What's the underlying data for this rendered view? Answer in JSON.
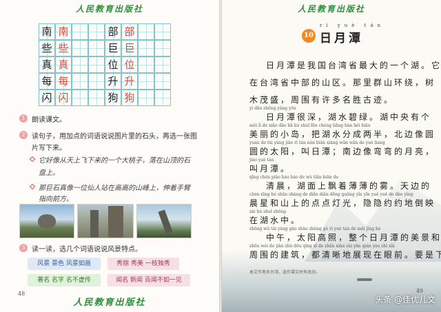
{
  "publisher": "人民教育出版社",
  "left": {
    "page_number": "48",
    "grid": [
      [
        {
          "c": "南",
          "t": "black"
        },
        {
          "c": "南",
          "t": "red"
        },
        {
          "c": "",
          "t": "black"
        },
        {
          "c": "",
          "t": "black"
        },
        {
          "c": "部",
          "t": "black"
        },
        {
          "c": "部",
          "t": "red"
        },
        {
          "c": "",
          "t": "black"
        },
        {
          "c": "",
          "t": "black"
        }
      ],
      [
        {
          "c": "些",
          "t": "black"
        },
        {
          "c": "些",
          "t": "red"
        },
        {
          "c": "",
          "t": "black"
        },
        {
          "c": "",
          "t": "black"
        },
        {
          "c": "巨",
          "t": "black"
        },
        {
          "c": "巨",
          "t": "red"
        },
        {
          "c": "",
          "t": "black"
        },
        {
          "c": "",
          "t": "black"
        }
      ],
      [
        {
          "c": "真",
          "t": "black"
        },
        {
          "c": "真",
          "t": "red"
        },
        {
          "c": "",
          "t": "black"
        },
        {
          "c": "",
          "t": "black"
        },
        {
          "c": "位",
          "t": "black"
        },
        {
          "c": "位",
          "t": "red"
        },
        {
          "c": "",
          "t": "black"
        },
        {
          "c": "",
          "t": "black"
        }
      ],
      [
        {
          "c": "每",
          "t": "black"
        },
        {
          "c": "每",
          "t": "red"
        },
        {
          "c": "",
          "t": "black"
        },
        {
          "c": "",
          "t": "black"
        },
        {
          "c": "升",
          "t": "black"
        },
        {
          "c": "升",
          "t": "red"
        },
        {
          "c": "",
          "t": "black"
        },
        {
          "c": "",
          "t": "black"
        }
      ],
      [
        {
          "c": "闪",
          "t": "black"
        },
        {
          "c": "闪",
          "t": "red"
        },
        {
          "c": "",
          "t": "black"
        },
        {
          "c": "",
          "t": "black"
        },
        {
          "c": "狗",
          "t": "black"
        },
        {
          "c": "狗",
          "t": "red"
        },
        {
          "c": "",
          "t": "black"
        },
        {
          "c": "",
          "t": "black"
        }
      ]
    ],
    "exercise1": "朗读课文。",
    "exercise2_line1": "读句子，用加点的词语说说图片里的石头，再选一张图",
    "exercise2_line2": "片写下来。",
    "example1_line1": "它好像从天上飞下来的一个大桃子，落在山顶的石",
    "example1_line2": "盘上。",
    "example2_line1": "那巨石真像一位仙人站在高高的山峰上，伸着手臂",
    "example2_line2": "指向前方。",
    "exercise3": "读一读，选几个词语说说风景特点。",
    "tags": [
      {
        "text": "风景  景色  风景如画",
        "color": "blue"
      },
      {
        "text": "秀丽  秀美  一枝独秀",
        "color": "pink"
      },
      {
        "text": "著名  名字  名不虚传",
        "color": "green"
      },
      {
        "text": "闻名  新闻  百闻不如一见",
        "color": "pink"
      }
    ]
  },
  "right": {
    "page_number": "49",
    "lesson_number": "10",
    "title_pinyin": "rì yuè tán",
    "title": "日月潭",
    "lines": [
      {
        "py": "",
        "hz": "日月潭是我国台湾省最大的一个湖。它"
      },
      {
        "py": "",
        "hz": "在台湾省中部的山区。那里群山环绕，树"
      },
      {
        "py": "",
        "hz": "木茂盛，周围有许多名胜古迹。"
      },
      {
        "py": "yì      dǎo                 zhōng yāng     yǒu",
        "hz": "日月潭很深，湖水碧绿。湖中央有个"
      },
      {
        "py": "měi   lì   de  xiǎo dǎo  bǎ  hú  shuǐ  fēn chéng liǎng bàn  běi  biān",
        "hz": "美丽的小岛，把湖水分成两半，北边像圆"
      },
      {
        "py": "yuán de  tài  yáng  jiào  rì  tán  nán  biān xiàng wān wān de  yuè  liang",
        "hz": "圆的太阳，叫日潭；南边像弯弯的月亮，"
      },
      {
        "py": "jiào yuè  tán",
        "hz": "叫月潭。"
      },
      {
        "py": "qīng  chén          piāo      báo  báo  de  wù   tiān biān de",
        "hz": "清晨，湖面上飘着薄薄的雾。天边的"
      },
      {
        "py": "chén xīng hé  shān shàng de  diǎn diǎn dēng guāng  yǐn  yǐn  yuē  yuē  de  dào  yìng",
        "hz": "晨星和山上的点点灯光，隐隐约约地倒映"
      },
      {
        "py": "zài  hú  shuǐ zhōng",
        "hz": "在湖水中。"
      },
      {
        "py": "zhōng wǔ   tài  yáng gāo  zhào  zhěng gè  rì  yuè  tán  de  měi  jǐng hé",
        "hz": "中午，太阳高照，整个日月潭的美景和"
      },
      {
        "py": "zhōu wéi  de  jiàn zhù   dōu qīng xī  de  zhǎn xiàn zài  yǎn  qián   yào  shì  xià",
        "hz": "周围的建筑，都清晰地展现在眼前。要是下"
      }
    ],
    "footnote": "本文作者系台湾，选作课文时有改动。"
  },
  "watermark": "头条 @佳优儿文"
}
